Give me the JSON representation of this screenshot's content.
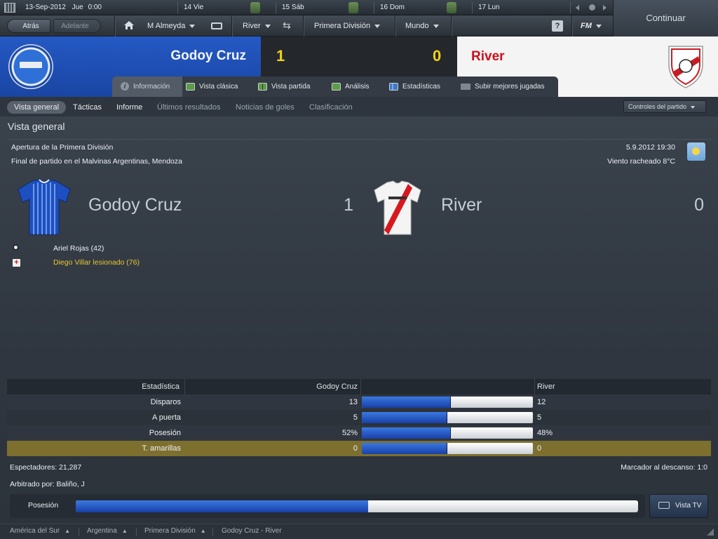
{
  "topbar": {
    "date": "13-Sep-2012",
    "day": "Jue",
    "time": "0:00",
    "days": [
      {
        "label": "14 Vie"
      },
      {
        "label": "15 Sáb"
      },
      {
        "label": "16 Dom"
      },
      {
        "label": "17 Lun"
      }
    ],
    "continue_label": "Continuar"
  },
  "navbar": {
    "back": "Atrás",
    "forward": "Adelante",
    "manager": "M Almeyda",
    "club": "River",
    "competition": "Primera División",
    "world": "Mundo",
    "help": "?",
    "fm": "FM"
  },
  "scoreboard": {
    "home_team": "Godoy Cruz",
    "away_team": "River",
    "home_score": "1",
    "away_score": "0",
    "colors": {
      "home": "#1f4fb8",
      "away_text": "#d0101a",
      "score": "#f2d21a"
    }
  },
  "tabs": [
    {
      "label": "Información",
      "icon": "info-icon"
    },
    {
      "label": "Vista clásica",
      "icon": "pitch-icon"
    },
    {
      "label": "Vista partida",
      "icon": "split-pitch-icon"
    },
    {
      "label": "Análisis",
      "icon": "analysis-icon"
    },
    {
      "label": "Estadísticas",
      "icon": "stats-icon"
    },
    {
      "label": "Subir mejores jugadas",
      "icon": "camera-icon"
    }
  ],
  "subnav": {
    "items": [
      "Vista general",
      "Tácticas",
      "Informe",
      "Últimos resultados",
      "Noticias de goles",
      "Clasificación"
    ],
    "controls": "Controles del partido"
  },
  "overview": {
    "title": "Vista general",
    "competition": "Apertura de la Primera División",
    "venue": "Final de partido en el Malvinas Argentinas, Mendoza",
    "datetime": "5.9.2012 19:30",
    "weather": "Viento racheado 8°C",
    "home_team": "Godoy Cruz",
    "home_score": "1",
    "away_team": "River",
    "away_score": "0",
    "events": [
      {
        "text": "Ariel Rojas (42)",
        "icon": "ball-icon"
      },
      {
        "text": "Diego Villar lesionado (76)",
        "icon": "injury-icon"
      }
    ]
  },
  "stats": {
    "header": {
      "label": "Estadística",
      "home": "Godoy Cruz",
      "away": "River"
    },
    "rows": [
      {
        "label": "Disparos",
        "home": "13",
        "away": "12",
        "home_frac": 0.52
      },
      {
        "label": "A puerta",
        "home": "5",
        "away": "5",
        "home_frac": 0.5
      },
      {
        "label": "Posesión",
        "home": "52%",
        "away": "48%",
        "home_frac": 0.52
      },
      {
        "label": "T. amarillas",
        "home": "0",
        "away": "0",
        "home_frac": 0.5
      }
    ]
  },
  "info": {
    "spectators": "Espectadores: 21,287",
    "halftime": "Marcador al descanso: 1:0",
    "referee": "Arbitrado por: Baliño, J"
  },
  "possession": {
    "label": "Posesión",
    "home_frac": 0.52,
    "tv": "Vista TV"
  },
  "breadcrumb": [
    "América del Sur",
    "Argentina",
    "Primera División",
    "Godoy Cruz - River"
  ]
}
